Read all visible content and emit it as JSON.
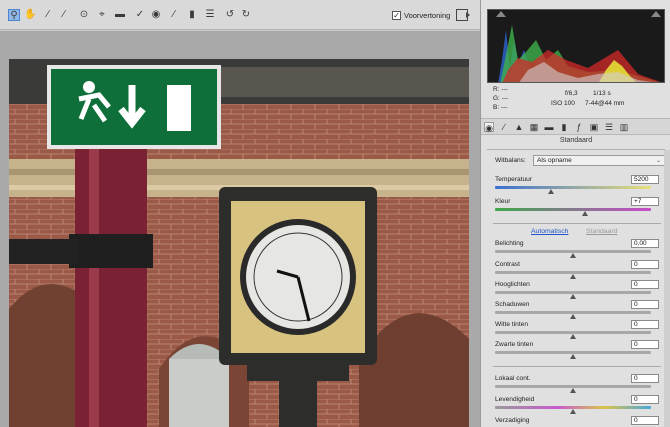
{
  "toolbar": {
    "tools": [
      "zoom-icon",
      "hand-icon",
      "eyedropper-icon",
      "color-sampler-icon",
      "target-adjust-icon",
      "crop-icon",
      "straighten-icon",
      "spot-removal-icon",
      "red-eye-icon",
      "adjustment-brush-icon",
      "graduated-filter-icon",
      "preferences-icon",
      "rotate-ccw-icon",
      "rotate-cw-icon"
    ],
    "preview_label": "Voorvertoning",
    "preview_checked": true
  },
  "readout": {
    "r_label": "R:",
    "g_label": "G:",
    "b_label": "B:",
    "r_value": "---",
    "g_value": "---",
    "b_value": "---",
    "aperture": "f/6,3",
    "shutter": "1/13 s",
    "iso": "ISO 100",
    "lens": "7-44@44 mm"
  },
  "panel": {
    "section_title": "Standaard",
    "white_balance_label": "Witbalans:",
    "white_balance_value": "Als opname",
    "auto_link": "Automatisch",
    "default_link": "Standaard",
    "sliders": [
      {
        "label": "Temperatuur",
        "value": "5200",
        "level": 0.36
      },
      {
        "label": "Kleur",
        "value": "+7",
        "level": 0.58
      },
      {
        "label": "Belichting",
        "value": "0,00",
        "level": 0.5
      },
      {
        "label": "Contrast",
        "value": "0",
        "level": 0.5
      },
      {
        "label": "Hooglichten",
        "value": "0",
        "level": 0.5
      },
      {
        "label": "Schaduwen",
        "value": "0",
        "level": 0.5
      },
      {
        "label": "Witte tinten",
        "value": "0",
        "level": 0.5
      },
      {
        "label": "Zwarte tinten",
        "value": "0",
        "level": 0.5
      },
      {
        "label": "Lokaal cont.",
        "value": "0",
        "level": 0.5
      },
      {
        "label": "Levendigheid",
        "value": "0",
        "level": 0.5
      },
      {
        "label": "Verzadiging",
        "value": "0",
        "level": 0.5
      }
    ]
  },
  "colors": {
    "accent": "#4a86d0",
    "link": "#1f56c9",
    "panel_bg": "#e0e0e0"
  }
}
